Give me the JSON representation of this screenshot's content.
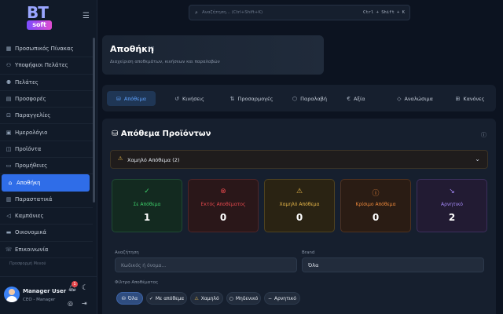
{
  "app": {
    "logo_bt": "BT",
    "logo_soft": "soft"
  },
  "sidebar": {
    "items": [
      {
        "label": "Προσωπικός Πίνακας",
        "icon": "dashboard-icon"
      },
      {
        "label": "Υποψήφιοι Πελάτες",
        "icon": "user-plus-icon"
      },
      {
        "label": "Πελάτες",
        "icon": "users-icon"
      },
      {
        "label": "Προσφορές",
        "icon": "document-icon"
      },
      {
        "label": "Παραγγελίες",
        "icon": "cart-icon"
      },
      {
        "label": "Ημερολόγιο",
        "icon": "calendar-icon"
      },
      {
        "label": "Προϊόντα",
        "icon": "box-icon"
      },
      {
        "label": "Προμήθειες",
        "icon": "truck-icon"
      },
      {
        "label": "Αποθήκη",
        "icon": "warehouse-icon"
      },
      {
        "label": "Παραστατικά",
        "icon": "invoice-icon"
      },
      {
        "label": "Καμπάνιες",
        "icon": "megaphone-icon"
      },
      {
        "label": "Οικονομικά",
        "icon": "wallet-icon"
      },
      {
        "label": "Επικοινωνία",
        "icon": "phone-icon"
      }
    ],
    "active_index": 8,
    "footer_text": "Προσφορμή Μενού"
  },
  "user": {
    "name": "Manager User",
    "role": "CEO - Manager",
    "notifications": "1"
  },
  "search": {
    "placeholder": "Αναζήτηση... (Ctrl+Shift+K)",
    "shortcut": "Ctrl + Shift + K"
  },
  "header": {
    "title": "Αποθήκη",
    "subtitle": "Διαχείριση αποθεμάτων, κινήσεων και παραλαβών"
  },
  "tabs": [
    {
      "label": "Απόθεμα",
      "icon": "stock-icon"
    },
    {
      "label": "Κινήσεις",
      "icon": "history-icon"
    },
    {
      "label": "Προσαρμογές",
      "icon": "adjust-icon"
    },
    {
      "label": "Παραλαβή",
      "icon": "package-icon"
    },
    {
      "label": "Αξία",
      "icon": "euro-icon"
    },
    {
      "label": "Αναλώσιμα",
      "icon": "droplet-icon"
    },
    {
      "label": "Κανόνες",
      "icon": "book-icon"
    }
  ],
  "panel": {
    "title": "Απόθεμα Προϊόντων",
    "low_stock_label": "Χαμηλό Απόθεμα (2)"
  },
  "stats": [
    {
      "label": "Σε Απόθεμα",
      "value": "1",
      "icon": "check-circle-icon",
      "color": "#3ecf6a"
    },
    {
      "label": "Εκτός Αποθέματος",
      "value": "0",
      "icon": "x-circle-icon",
      "color": "#e5484d"
    },
    {
      "label": "Χαμηλό Απόθεμα",
      "value": "0",
      "icon": "warning-icon",
      "color": "#e8b84a"
    },
    {
      "label": "Κρίσιμο Απόθεμα",
      "value": "0",
      "icon": "alert-circle-icon",
      "color": "#f08a3c"
    },
    {
      "label": "Αρνητικό",
      "value": "2",
      "icon": "trend-down-icon",
      "color": "#a78bfa"
    }
  ],
  "filters": {
    "search_label": "Αναζήτηση",
    "search_placeholder": "Κωδικός ή όνομα...",
    "brand_label": "Brand",
    "brand_value": "Όλα",
    "stock_filter_label": "Φίλτρο Αποθέματος",
    "chips": [
      {
        "label": "Όλα",
        "icon": "stock-icon"
      },
      {
        "label": "Με απόθεμα",
        "icon": "check-icon"
      },
      {
        "label": "Χαμηλό",
        "icon": "warning-icon"
      },
      {
        "label": "Μηδενικό",
        "icon": "circle-icon"
      },
      {
        "label": "Αρνητικό",
        "icon": "minus-icon"
      }
    ]
  }
}
